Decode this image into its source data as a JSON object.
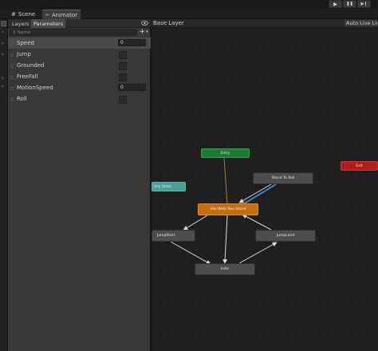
{
  "toolbar": {
    "buttons": [
      {
        "name": "play-button",
        "icon": "play-icon",
        "glyph": "▶"
      },
      {
        "name": "pause-button",
        "icon": "pause-icon",
        "glyph": "❚❚"
      },
      {
        "name": "step-button",
        "icon": "step-icon",
        "glyph": "▶❙"
      }
    ]
  },
  "tabs": {
    "scene": {
      "label": "Scene",
      "icon": "scene-grid-icon"
    },
    "animator": {
      "label": "Animator",
      "icon": "animator-icon"
    }
  },
  "panel": {
    "tab_layers": "Layers",
    "tab_parameters": "Parameters",
    "search_placeholder": "Name",
    "add_glyph": "+",
    "parameters": [
      {
        "name": "Speed",
        "type": "float",
        "value": "0"
      },
      {
        "name": "Jump",
        "type": "bool",
        "value": ""
      },
      {
        "name": "Grounded",
        "type": "bool",
        "value": ""
      },
      {
        "name": "FreeFall",
        "type": "bool",
        "value": ""
      },
      {
        "name": "MotionSpeed",
        "type": "float",
        "value": "0"
      },
      {
        "name": "Roll",
        "type": "bool",
        "value": ""
      }
    ]
  },
  "graph": {
    "breadcrumb": "Base Layer",
    "auto_live_link": "Auto Live Lin",
    "nodes": {
      "entry": "Entry",
      "exit": "Exit",
      "any_state": "Any State",
      "stand_to_roll": "Stand To Roll",
      "idle_walk_run": "Idle Walk Run Stand",
      "jump_start": "JumpStart",
      "jump_land": "JumpLand",
      "in_air": "InAir"
    }
  },
  "colors": {
    "entry": "#1e7a35",
    "exit": "#b01d1d",
    "any_state": "#4b9f96",
    "default_state": "#c46e12",
    "state": "#4d4d4d",
    "transition": "#d8d8d8",
    "active_transition": "#3b7fcf"
  }
}
